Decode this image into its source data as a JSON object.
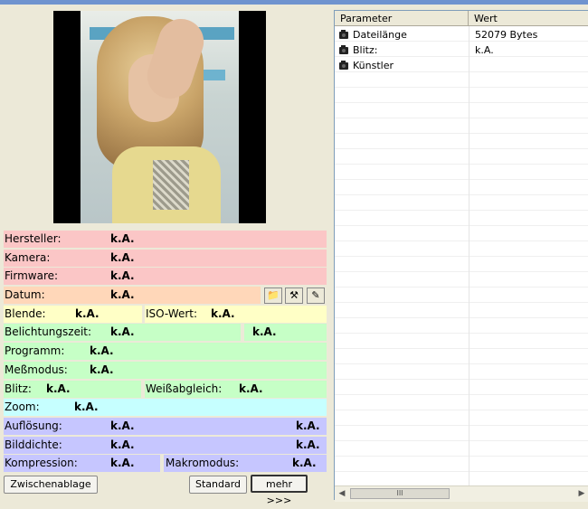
{
  "fields": {
    "hersteller": {
      "label": "Hersteller:",
      "value": "k.A."
    },
    "kamera": {
      "label": "Kamera:",
      "value": "k.A."
    },
    "firmware": {
      "label": "Firmware:",
      "value": "k.A."
    },
    "datum": {
      "label": "Datum:",
      "value": "k.A."
    },
    "blende": {
      "label": "Blende:",
      "value": "k.A."
    },
    "iso": {
      "label": "ISO-Wert:",
      "value": "k.A."
    },
    "belichtung": {
      "label": "Belichtungszeit:",
      "value": "k.A.",
      "value2": "k.A."
    },
    "programm": {
      "label": "Programm:",
      "value": "k.A."
    },
    "messmodus": {
      "label": "Meßmodus:",
      "value": "k.A."
    },
    "blitz": {
      "label": "Blitz:",
      "value": "k.A."
    },
    "weiss": {
      "label": "Weißabgleich:",
      "value": "k.A."
    },
    "zoom": {
      "label": "Zoom:",
      "value": "k.A."
    },
    "aufloesung": {
      "label": "Auflösung:",
      "value": "k.A.",
      "value2": "k.A."
    },
    "bilddichte": {
      "label": "Bilddichte:",
      "value": "k.A.",
      "value2": "k.A."
    },
    "kompression": {
      "label": "Kompression:",
      "value": "k.A."
    },
    "makro": {
      "label": "Makromodus:",
      "value": "k.A."
    }
  },
  "buttons": {
    "clipboard_label": "Zwischenablage",
    "standard_label": "Standard",
    "more_label": "mehr >>>"
  },
  "list": {
    "col_param": "Parameter",
    "col_value": "Wert",
    "rows": [
      {
        "name": "Dateilänge",
        "value": "52079 Bytes"
      },
      {
        "name": "Blitz:",
        "value": "k.A."
      },
      {
        "name": "Künstler",
        "value": ""
      }
    ]
  },
  "scroll": {
    "thumb_glyph": "III"
  }
}
